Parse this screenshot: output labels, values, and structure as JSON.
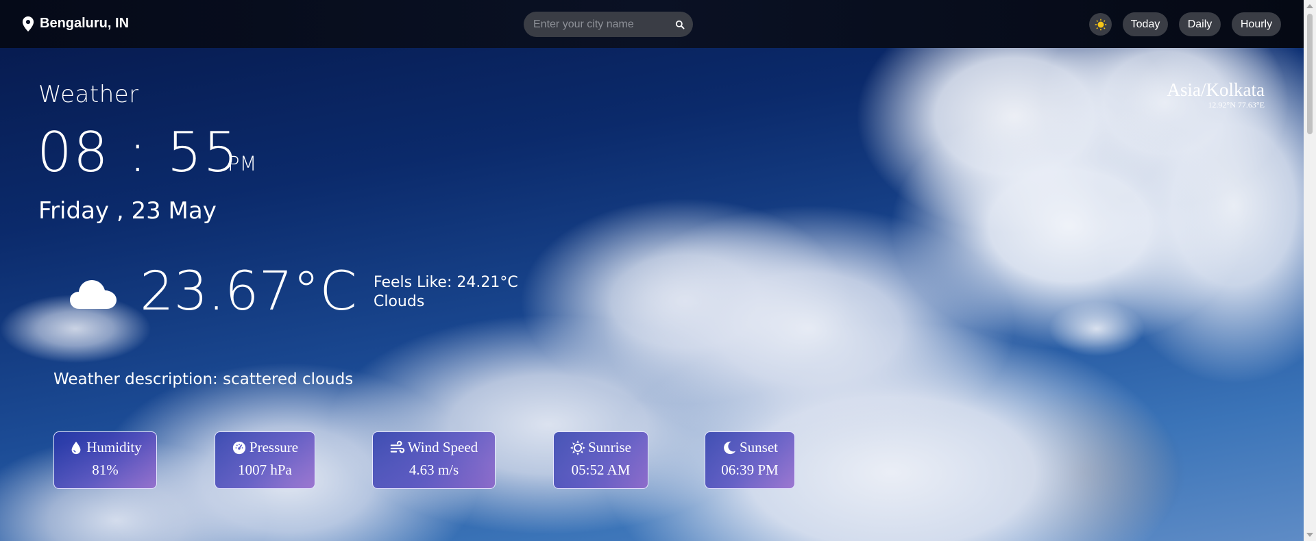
{
  "header": {
    "location": "Bengaluru, IN",
    "search_placeholder": "Enter your city name",
    "buttons": {
      "today": "Today",
      "daily": "Daily",
      "hourly": "Hourly"
    }
  },
  "main": {
    "heading": "Weather",
    "time": "08 : 55",
    "ampm": "PM",
    "date": "Friday , 23 May",
    "temperature": "23.67°C",
    "feels_like": "Feels Like: 24.21°C",
    "condition": "Clouds",
    "description": "Weather description: scattered clouds"
  },
  "timezone": {
    "name": "Asia/Kolkata",
    "coords": "12.92°N 77.63°E"
  },
  "stats": {
    "humidity": {
      "label": "Humidity",
      "value": "81%"
    },
    "pressure": {
      "label": "Pressure",
      "value": "1007 hPa"
    },
    "wind": {
      "label": "Wind Speed",
      "value": "4.63 m/s"
    },
    "sunrise": {
      "label": "Sunrise",
      "value": "05:52 AM"
    },
    "sunset": {
      "label": "Sunset",
      "value": "06:39 PM"
    }
  },
  "icons": {
    "location": "map-pin-icon",
    "search": "search-icon",
    "theme": "sun-icon",
    "weather": "cloud-icon",
    "humidity": "droplet-icon",
    "pressure": "gauge-icon",
    "wind": "wind-icon",
    "sunrise": "sun-icon",
    "sunset": "moon-icon"
  },
  "colors": {
    "topbar": "#0a1124",
    "pill": "#3a3d45",
    "sun": "#f5c518"
  }
}
